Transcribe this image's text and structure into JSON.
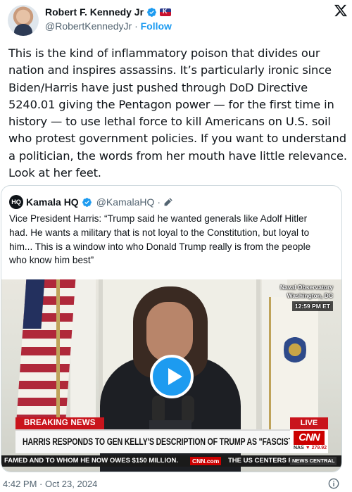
{
  "author": {
    "name": "Robert F. Kennedy Jr",
    "handle": "@RobertKennedyJr",
    "separator": "·",
    "follow_label": "Follow"
  },
  "tweet": {
    "lines": [
      "This is the kind of inflammatory poison that divides our",
      "nation and inspires assassins. It’s particularly ironic since",
      "Biden/Harris have just pushed through DoD Directive",
      "5240.01 giving the Pentagon power — for the first time in",
      "history — to use lethal force to kill Americans on U.S. soil",
      "who protest government policies. If you want to understand",
      "a politician, the words from her mouth have little relevance.",
      "Look at her feet."
    ]
  },
  "quote": {
    "avatar_text": "HQ",
    "name": "Kamala HQ",
    "handle": "@KamalaHQ",
    "separator": "·",
    "lines": [
      "Vice President Harris: “Trump said he wanted generals like Adolf Hitler",
      "had. He wants a military that is not loyal to the Constitution, but loyal to",
      "him... This is a window into who Donald Trump really is from the people",
      "who know him best”"
    ]
  },
  "video": {
    "location_line1": "Naval Observatory",
    "location_line2": "Washington, DC",
    "time": "12:59 PM ET",
    "breaking": "BREAKING NEWS",
    "live": "LIVE",
    "headline": "HARRIS RESPONDS TO GEN KELLY'S DESCRIPTION OF TRUMP AS \"FASCIST\"",
    "network": "CNN",
    "market": "NAS",
    "market_value": "▼ 279.92",
    "ticker_left": "FAMED AND TO WHOM HE NOW OWES $150 MILLION.",
    "ticker_site": "CNN.com",
    "ticker_right": "THE US CENTERS F",
    "ticker_tag": "NEWS CENTRAL"
  },
  "footer": {
    "timestamp": "4:42 PM · Oct 23, 2024"
  },
  "colors": {
    "accent": "#1d9bf0",
    "cnn_red": "#cc0000",
    "text": "#0f1419",
    "muted": "#536471"
  }
}
